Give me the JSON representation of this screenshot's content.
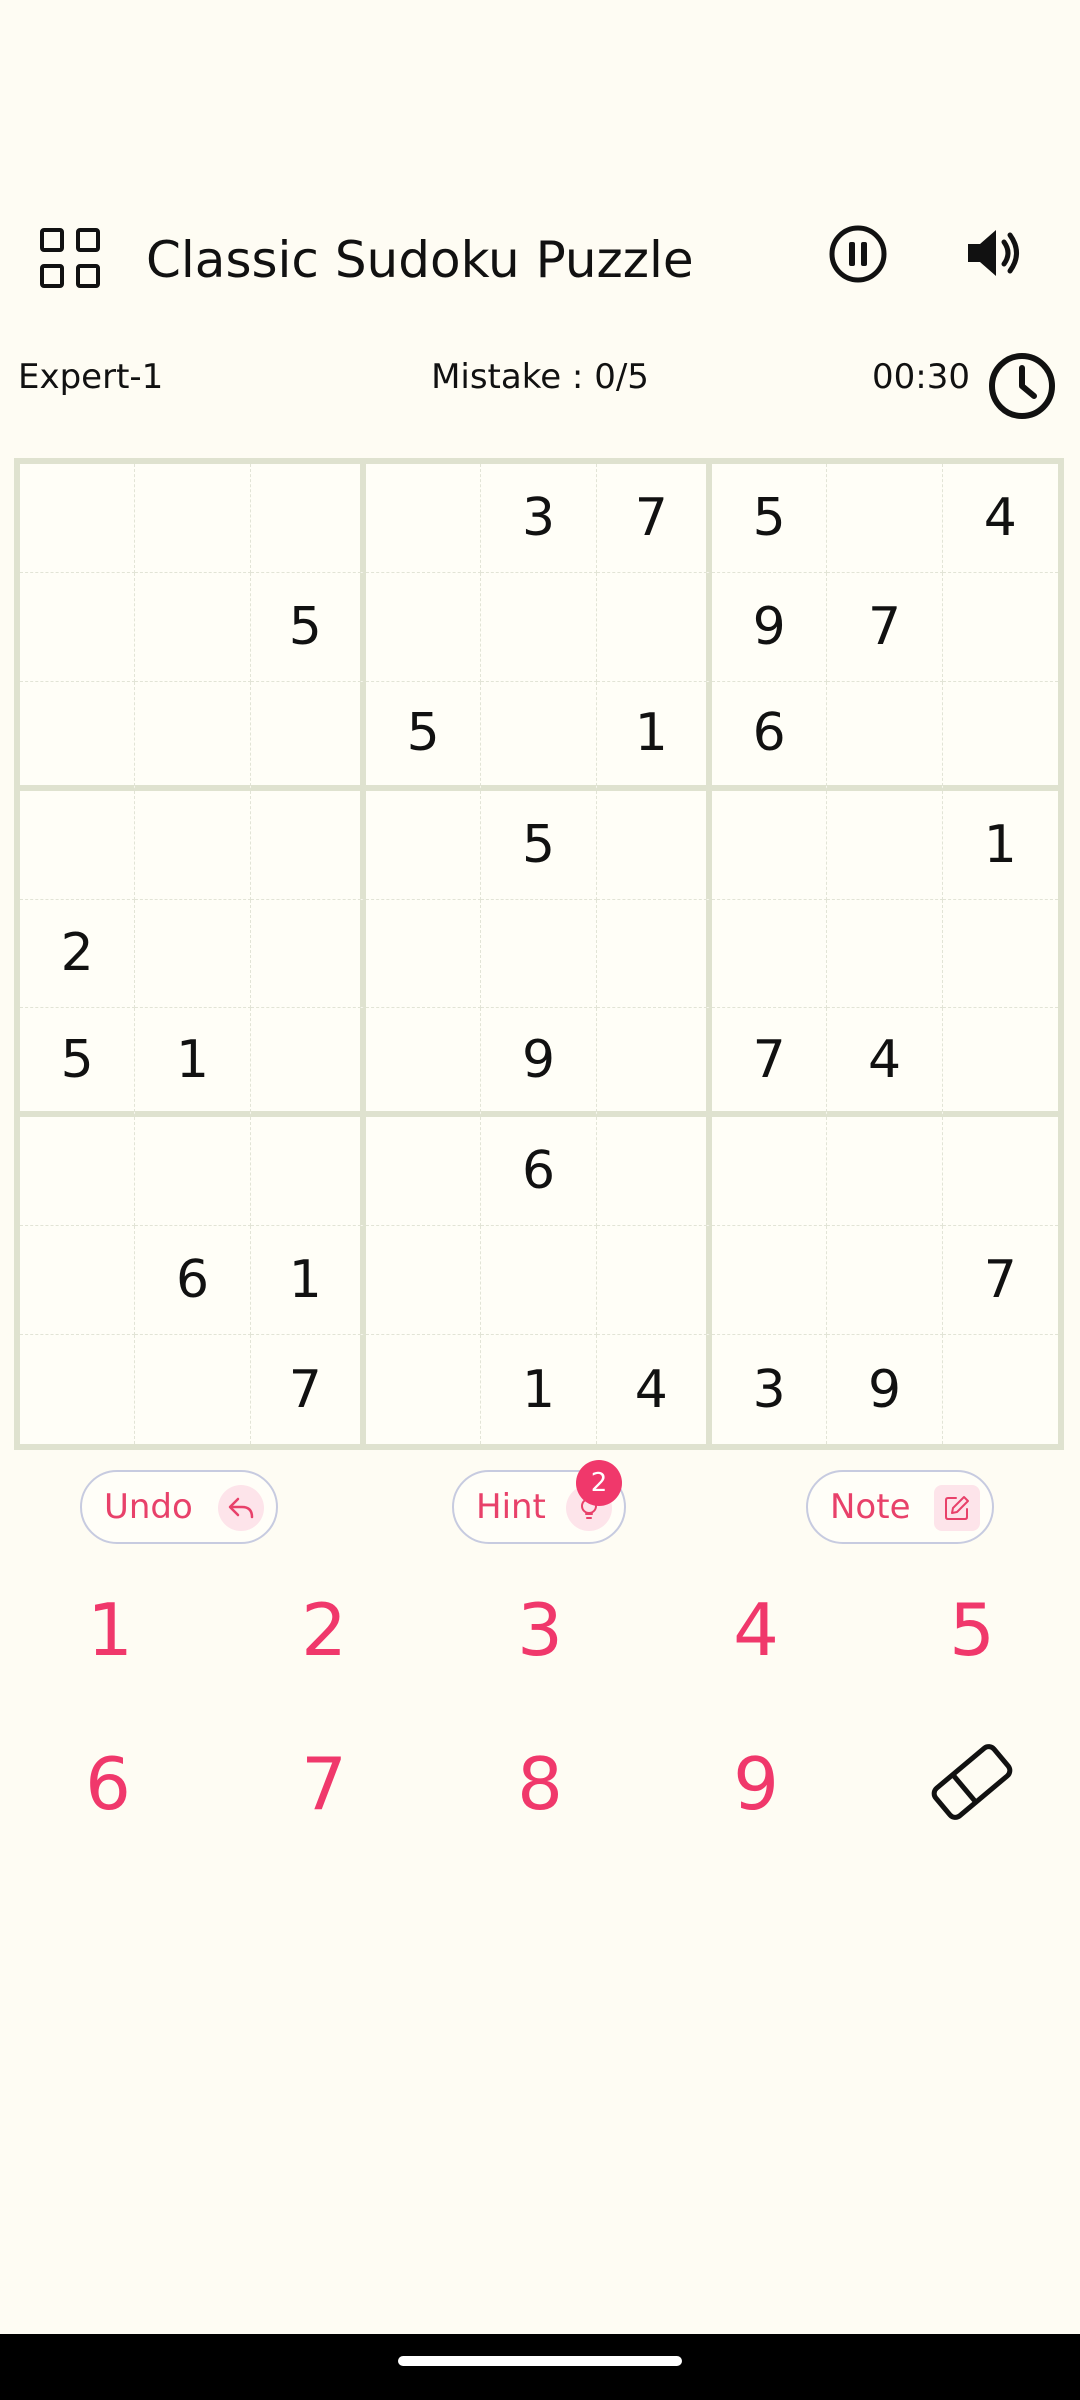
{
  "header": {
    "title": "Classic Sudoku Puzzle",
    "menu_icon": "grid-icon",
    "pause_icon": "pause-icon",
    "sound_icon": "speaker-icon"
  },
  "status": {
    "level": "Expert-1",
    "mistake": "Mistake : 0/5",
    "timer": "00:30",
    "clock_icon": "clock-icon"
  },
  "board": {
    "cells": [
      [
        "",
        "",
        "",
        "",
        "3",
        "7",
        "5",
        "",
        "4"
      ],
      [
        "",
        "",
        "5",
        "",
        "",
        "",
        "9",
        "7",
        ""
      ],
      [
        "",
        "",
        "",
        "5",
        "",
        "1",
        "6",
        "",
        ""
      ],
      [
        "",
        "",
        "",
        "",
        "5",
        "",
        "",
        "",
        "1"
      ],
      [
        "2",
        "",
        "",
        "",
        "",
        "",
        "",
        "",
        ""
      ],
      [
        "5",
        "1",
        "",
        "",
        "9",
        "",
        "7",
        "4",
        ""
      ],
      [
        "",
        "",
        "",
        "",
        "6",
        "",
        "",
        "",
        ""
      ],
      [
        "",
        "6",
        "1",
        "",
        "",
        "",
        "",
        "",
        "7"
      ],
      [
        "",
        "",
        "7",
        "",
        "1",
        "4",
        "3",
        "9",
        ""
      ]
    ]
  },
  "actions": {
    "undo_label": "Undo",
    "hint_label": "Hint",
    "hint_count": "2",
    "note_label": "Note"
  },
  "pad": {
    "row1": [
      "1",
      "2",
      "3",
      "4",
      "5"
    ],
    "row2": [
      "6",
      "7",
      "8",
      "9"
    ],
    "eraser_icon": "eraser-icon"
  },
  "colors": {
    "accent": "#f0386b",
    "grid_line": "#dfe2cf",
    "background": "#fefcf3"
  }
}
